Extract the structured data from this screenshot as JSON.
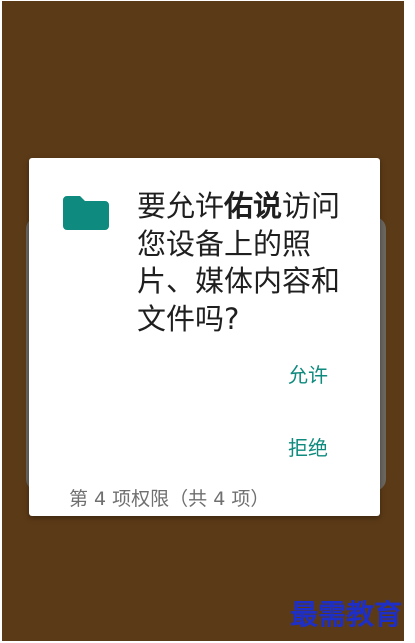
{
  "dialog": {
    "message_prefix": "要允许",
    "app_name": "佑说",
    "message_suffix": "访问您设备上的照片、媒体内容和文件吗?",
    "allow_label": "允许",
    "deny_label": "拒绝",
    "counter_text": "第 4 项权限（共 4 项）",
    "icon": "folder-icon"
  },
  "watermark": {
    "text": "最需教育"
  },
  "colors": {
    "background": "#5b3a17",
    "accent": "#0f8a7e",
    "icon": "#0f8a7e",
    "watermark": "#1d2fc7"
  }
}
